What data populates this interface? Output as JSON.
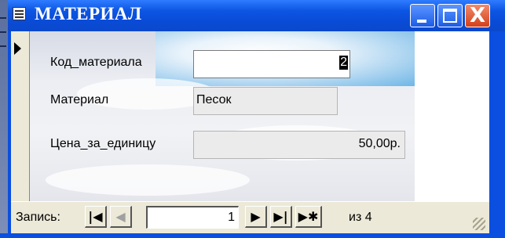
{
  "window": {
    "title": "МАТЕРИАЛ",
    "title_icon": "form-icon",
    "buttons": [
      "minimize-icon",
      "maximize-icon",
      "close-icon"
    ],
    "close_glyph": "X"
  },
  "form": {
    "fields": [
      {
        "label": "Код_материала",
        "value": "2"
      },
      {
        "label": "Материал",
        "value": "Песок"
      },
      {
        "label": "Цена_за_единицу",
        "value": "50,00р."
      }
    ]
  },
  "navigation": {
    "label": "Запись:",
    "first": "|◀",
    "prev": "◀",
    "current": "1",
    "next": "▶",
    "last": "▶|",
    "new": "▶✱",
    "count": "из 4"
  },
  "colors": {
    "titlebar": "#0a4fe0",
    "close_button": "#d4401a",
    "form_background": "#ece9d8"
  }
}
